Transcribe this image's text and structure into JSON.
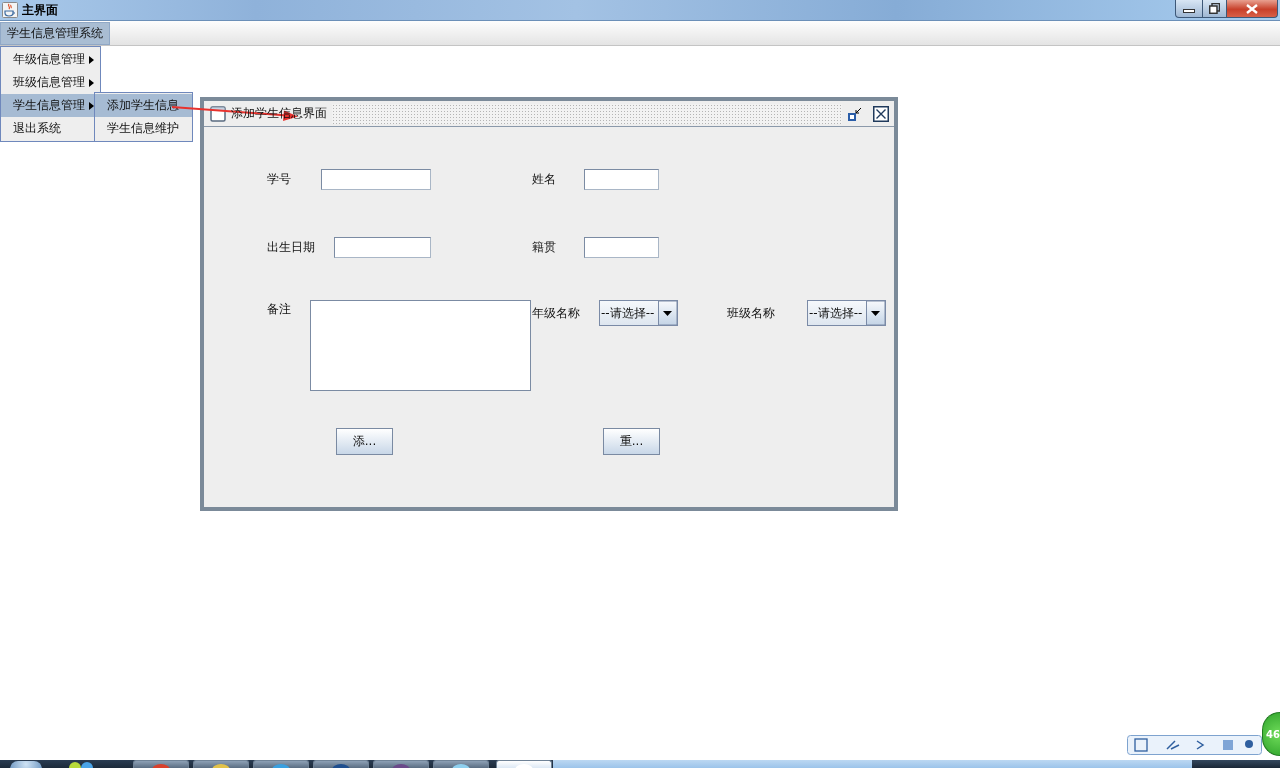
{
  "window": {
    "title": "主界面"
  },
  "menu_bar": [
    {
      "label": "学生信息管理系统",
      "selected": true
    }
  ],
  "menu": [
    {
      "label": "年级信息管理",
      "has_submenu": true,
      "selected": false
    },
    {
      "label": "班级信息管理",
      "has_submenu": true,
      "selected": false
    },
    {
      "label": "学生信息管理",
      "has_submenu": true,
      "selected": true
    },
    {
      "label": "退出系统",
      "has_submenu": false,
      "selected": false
    }
  ],
  "submenu": [
    {
      "label": "添加学生信息",
      "selected": true
    },
    {
      "label": "学生信息维护",
      "selected": false
    }
  ],
  "internal_frame": {
    "title": "添加学生信息界面",
    "rows": [
      [
        {
          "kind": "text",
          "label": "学号"
        },
        {
          "kind": "text",
          "label": "姓名"
        }
      ],
      [
        {
          "kind": "text",
          "label": "出生日期"
        },
        {
          "kind": "text",
          "label": "籍贯"
        }
      ],
      [
        {
          "kind": "textarea",
          "label": "备注"
        },
        {
          "kind": "combo",
          "label": "年级名称",
          "value": "--请选择--"
        },
        {
          "kind": "combo",
          "label": "班级名称",
          "value": "--请选择--"
        }
      ]
    ],
    "buttons": [
      "添...",
      "重..."
    ]
  },
  "badge": {
    "text": "46"
  }
}
